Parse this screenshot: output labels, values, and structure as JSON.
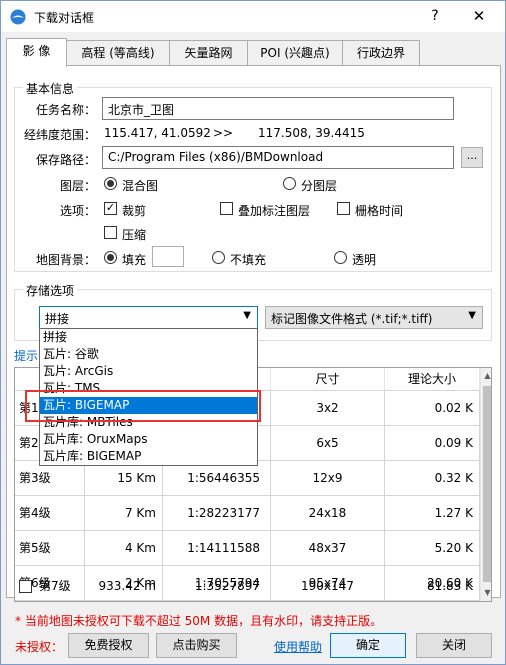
{
  "window": {
    "title": "下载对话框",
    "help": "?",
    "close": "✕"
  },
  "tabs": [
    "影 像",
    "高程 (等高线)",
    "矢量路网",
    "POI (兴趣点)",
    "行政边界"
  ],
  "basic": {
    "section_title": "基本信息",
    "task_label": "任务名称：",
    "task_value": "北京市_卫图",
    "range_label": "经纬度范围：",
    "range_from": "115.417, 41.0592",
    "range_arrow": ">>",
    "range_to": "117.508, 39.4415",
    "path_label": "保存路径：",
    "path_value": "C:/Program Files (x86)/BMDownload",
    "browse": "...",
    "layer_label": "图层：",
    "layer_opt1": "混合图",
    "layer_opt2": "分图层",
    "options_label": "选项：",
    "opt_crop": "裁剪",
    "opt_overlay": "叠加标注图层",
    "opt_grid": "栅格时间",
    "opt_compress": "压缩",
    "bg_label": "地图背景：",
    "bg_fill": "填充",
    "bg_nofill": "不填充",
    "bg_transparent": "透明"
  },
  "storage": {
    "section_title": "存储选项",
    "selected": "拼接",
    "format": "标记图像文件格式 (*.tif;*.tiff)",
    "dropdown_items": [
      "拼接",
      "瓦片: 谷歌",
      "瓦片: ArcGis",
      "瓦片: TMS",
      "瓦片: BIGEMAP",
      "瓦片库: MBTiles",
      "瓦片库: OruxMaps",
      "瓦片库: BIGEMAP"
    ],
    "selected_index": 4
  },
  "tip": "提示",
  "grid": {
    "headers": [
      "尺寸",
      "理论大小"
    ],
    "rows": [
      {
        "level": "第1级",
        "res": "",
        "scale": "",
        "size": "3x2",
        "est": "0.02 K",
        "check": false
      },
      {
        "level": "第2级",
        "res": "",
        "scale": "",
        "size": "6x5",
        "est": "0.09 K",
        "check": false
      },
      {
        "level": "第3级",
        "res": "15 Km",
        "scale": "1:56446355",
        "size": "12x9",
        "est": "0.32 K",
        "check": false
      },
      {
        "level": "第4级",
        "res": "7 Km",
        "scale": "1:28223177",
        "size": "24x18",
        "est": "1.27 K",
        "check": false
      },
      {
        "level": "第5级",
        "res": "4 Km",
        "scale": "1:14111588",
        "size": "48x37",
        "est": "5.20 K",
        "check": false
      },
      {
        "level": "第6级",
        "res": "2 Km",
        "scale": "1:7055794",
        "size": "95x74",
        "est": "20.60 K",
        "check": false
      },
      {
        "level": "第7级",
        "res": "933.42  m",
        "scale": "1:3527897",
        "size": "190x147",
        "est": "81.83 K",
        "check": true
      }
    ]
  },
  "footer": {
    "warning": "* 当前地图未授权可下载不超过 50M 数据，且有水印，请支持正版。",
    "unauthorized": "未授权：",
    "free_auth": "免费授权",
    "buy": "点击购买",
    "help": "使用帮助",
    "ok": "确定",
    "close": "关闭"
  }
}
